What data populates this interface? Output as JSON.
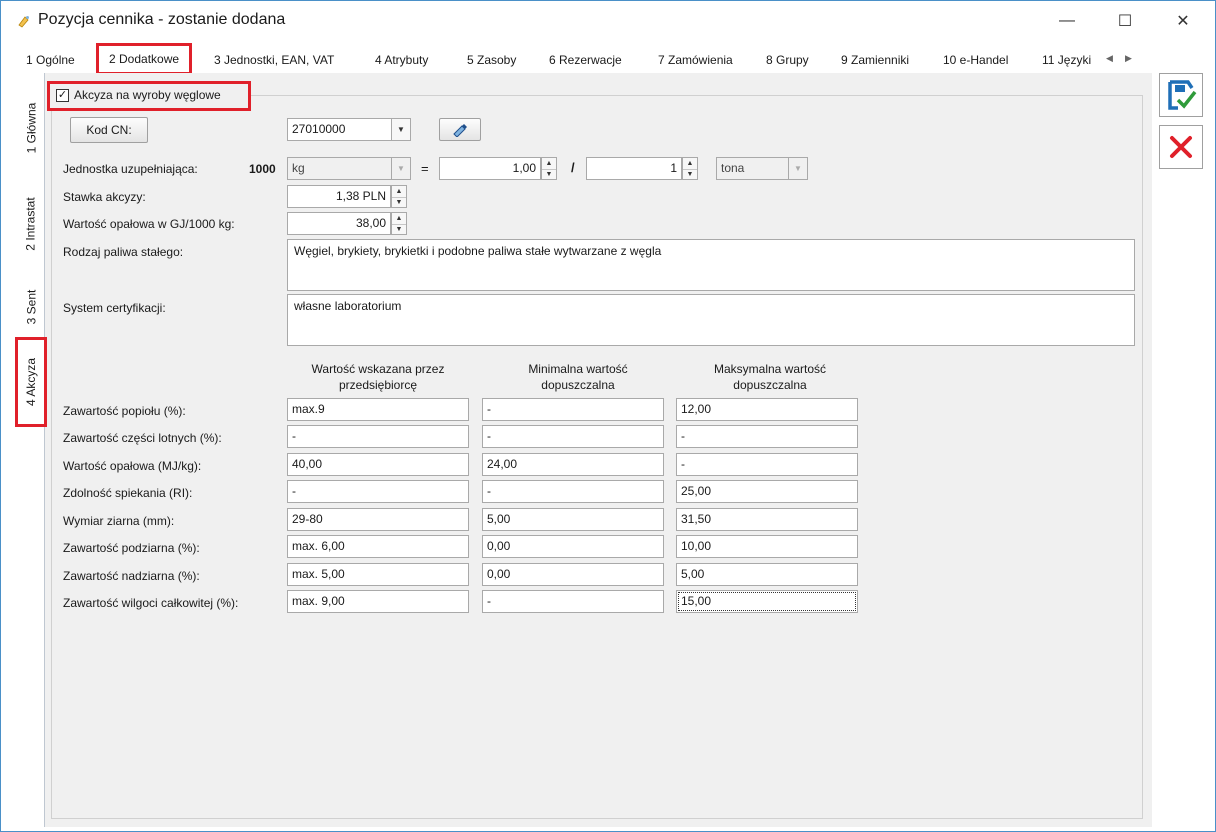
{
  "window": {
    "title": "Pozycja cennika - zostanie dodana",
    "minimize_glyph": "—",
    "maximize_glyph": "☐",
    "close_glyph": "✕"
  },
  "tabs": [
    {
      "label": "1 Ogólne"
    },
    {
      "label": "2 Dodatkowe",
      "active": true
    },
    {
      "label": "3 Jednostki, EAN, VAT"
    },
    {
      "label": "4 Atrybuty"
    },
    {
      "label": "5 Zasoby"
    },
    {
      "label": "6 Rezerwacje"
    },
    {
      "label": "7 Zamówienia"
    },
    {
      "label": "8 Grupy"
    },
    {
      "label": "9 Zamienniki"
    },
    {
      "label": "10 e-Handel"
    },
    {
      "label": "11 Języki"
    }
  ],
  "vtabs": [
    {
      "label": "1 Główna"
    },
    {
      "label": "2 Intrastat"
    },
    {
      "label": "3 Sent"
    },
    {
      "label": "4 Akcyza",
      "active": true
    }
  ],
  "form": {
    "akcyza_checkbox_label": "Akcyza na wyroby węglowe",
    "akcyza_checked": true,
    "kod_cn_button": "Kod CN:",
    "kod_cn_value": "27010000",
    "jednostka_label": "Jednostka uzupełniająca:",
    "jednostka_qty": "1000",
    "jednostka_unit": "kg",
    "equals": "=",
    "ratio_num": "1,00",
    "slash": "/",
    "ratio_den": "1",
    "ratio_unit": "tona",
    "stawka_label": "Stawka akcyzy:",
    "stawka_value": "1,38 PLN",
    "wartosc_opalowa_gj_label": "Wartość opałowa w GJ/1000 kg:",
    "wartosc_opalowa_gj_value": "38,00",
    "rodzaj_label": "Rodzaj paliwa stałego:",
    "rodzaj_value": "Węgiel, brykiety, brykietki i podobne paliwa stałe wytwarzane z węgla",
    "system_label": "System certyfikacji:",
    "system_value": "własne laboratorium"
  },
  "table": {
    "headers": [
      "Wartość wskazana przez przedsiębiorcę",
      "Minimalna wartość dopuszczalna",
      "Maksymalna wartość dopuszczalna"
    ],
    "rows": [
      {
        "label": "Zawartość popiołu (%):",
        "values": [
          "max.9",
          "-",
          "12,00"
        ]
      },
      {
        "label": "Zawartość części lotnych (%):",
        "values": [
          "-",
          "-",
          "-"
        ]
      },
      {
        "label": "Wartość opałowa (MJ/kg):",
        "values": [
          "40,00",
          "24,00",
          "-"
        ]
      },
      {
        "label": "Zdolność spiekania (RI):",
        "values": [
          "-",
          "-",
          "25,00"
        ]
      },
      {
        "label": "Wymiar ziarna (mm):",
        "values": [
          "29-80",
          "5,00",
          "31,50"
        ]
      },
      {
        "label": "Zawartość podziarna (%):",
        "values": [
          "max. 6,00",
          "0,00",
          "10,00"
        ]
      },
      {
        "label": "Zawartość nadziarna (%):",
        "values": [
          "max. 5,00",
          "0,00",
          "5,00"
        ]
      },
      {
        "label": "Zawartość wilgoci całkowitej (%):",
        "values": [
          "max. 9,00",
          "-",
          "15,00"
        ]
      }
    ]
  },
  "colors": {
    "highlight": "#e0202a",
    "save_icon": "#1f6fb7",
    "cancel_icon": "#e0202a"
  },
  "icons": {
    "save": "save-disk-check-icon",
    "cancel": "cancel-x-icon",
    "edit": "edit-pencil-icon"
  }
}
